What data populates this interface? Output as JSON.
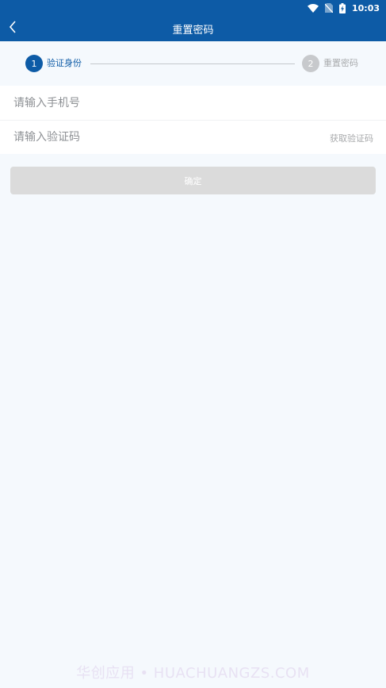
{
  "status_bar": {
    "time": "10:03",
    "icons": [
      "wifi-icon",
      "no-sim-icon",
      "battery-charging-icon"
    ]
  },
  "app_bar": {
    "title": "重置密码",
    "back_icon": "chevron-left-icon"
  },
  "steps": [
    {
      "number": "1",
      "label": "验证身份",
      "active": true
    },
    {
      "number": "2",
      "label": "重置密码",
      "active": false
    }
  ],
  "form": {
    "phone_placeholder": "请输入手机号",
    "phone_value": "",
    "code_placeholder": "请输入验证码",
    "code_value": "",
    "get_code_label": "获取验证码"
  },
  "confirm_label": "确定",
  "watermark": "华创应用 • HUACHUANGZS.COM",
  "colors": {
    "primary": "#0d5ba6",
    "background": "#f5f9fd",
    "inactive_step": "#c7c9cc",
    "button_disabled": "#dbdbdb"
  }
}
